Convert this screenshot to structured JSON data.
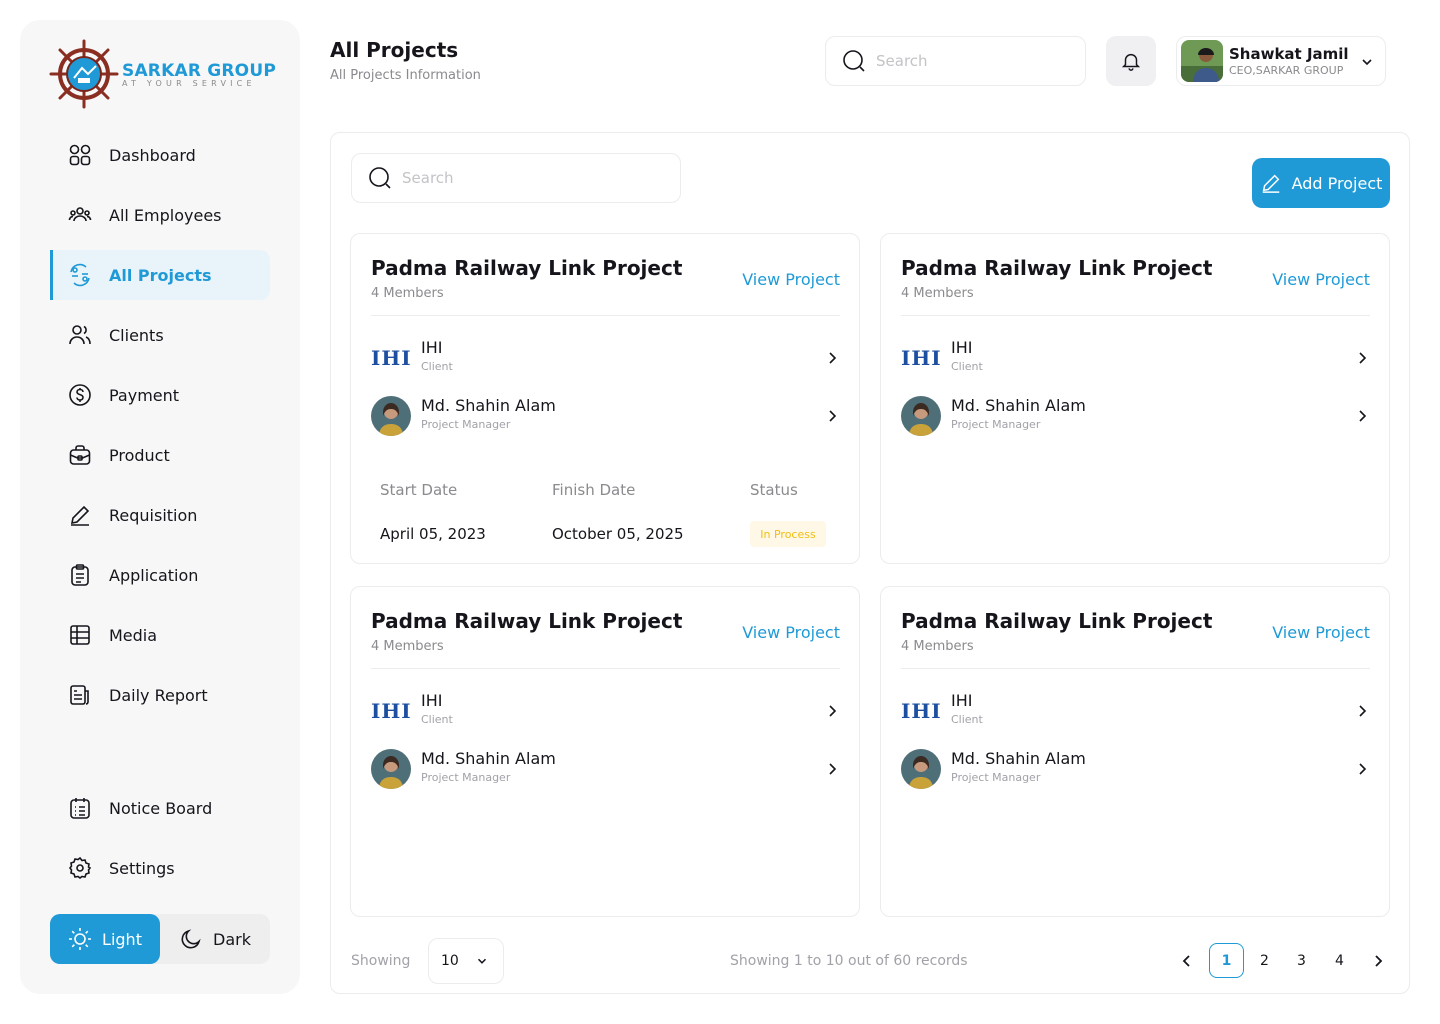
{
  "brand": {
    "name": "SARKAR GROUP",
    "tagline": "AT YOUR SERVICE"
  },
  "nav": {
    "items": [
      {
        "label": "Dashboard",
        "icon": "dashboard-icon"
      },
      {
        "label": "All Employees",
        "icon": "employees-icon"
      },
      {
        "label": "All Projects",
        "icon": "projects-icon",
        "active": true
      },
      {
        "label": "Clients",
        "icon": "clients-icon"
      },
      {
        "label": "Payment",
        "icon": "dollar-icon"
      },
      {
        "label": "Product",
        "icon": "briefcase-icon"
      },
      {
        "label": "Requisition",
        "icon": "pen-icon"
      },
      {
        "label": "Application",
        "icon": "clipboard-icon"
      },
      {
        "label": "Media",
        "icon": "grid-icon"
      },
      {
        "label": "Daily Report",
        "icon": "report-icon"
      }
    ],
    "bottom": [
      {
        "label": "Notice Board",
        "icon": "notice-icon"
      },
      {
        "label": "Settings",
        "icon": "gear-icon"
      }
    ]
  },
  "theme": {
    "light": "Light",
    "dark": "Dark",
    "selected": "Light"
  },
  "header": {
    "title": "All Projects",
    "subtitle": "All Projects Information",
    "search_placeholder": "Search"
  },
  "user": {
    "name": "Shawkat Jamil",
    "role": "CEO,SARKAR GROUP"
  },
  "panel": {
    "search_placeholder": "Search",
    "add_label": "Add Project"
  },
  "projects": [
    {
      "title": "Padma Railway Link Project",
      "members": "4 Members",
      "link": "View Project",
      "client_logo": "IHI",
      "client_name": "IHI",
      "client_role": "Client",
      "manager_name": "Md. Shahin Alam",
      "manager_role": "Project Manager",
      "start_label": "Start Date",
      "finish_label": "Finish Date",
      "status_label": "Status",
      "start": "April 05, 2023",
      "finish": "October 05, 2025",
      "status": "In Process"
    },
    {
      "title": "Padma Railway Link Project",
      "members": "4 Members",
      "link": "View Project",
      "client_logo": "IHI",
      "client_name": "IHI",
      "client_role": "Client",
      "manager_name": "Md. Shahin Alam",
      "manager_role": "Project Manager"
    },
    {
      "title": "Padma Railway Link Project",
      "members": "4 Members",
      "link": "View Project",
      "client_logo": "IHI",
      "client_name": "IHI",
      "client_role": "Client",
      "manager_name": "Md. Shahin Alam",
      "manager_role": "Project Manager"
    },
    {
      "title": "Padma Railway Link Project",
      "members": "4 Members",
      "link": "View Project",
      "client_logo": "IHI",
      "client_name": "IHI",
      "client_role": "Client",
      "manager_name": "Md. Shahin Alam",
      "manager_role": "Project Manager"
    }
  ],
  "footer": {
    "showing_label": "Showing",
    "per_page": "10",
    "records": "Showing 1 to 10 out of 60 records",
    "pages": [
      "1",
      "2",
      "3",
      "4"
    ],
    "current_page": "1"
  },
  "colors": {
    "accent": "#1f9ad6",
    "status_bg": "#fff8e6",
    "status_text": "#efbe12"
  }
}
